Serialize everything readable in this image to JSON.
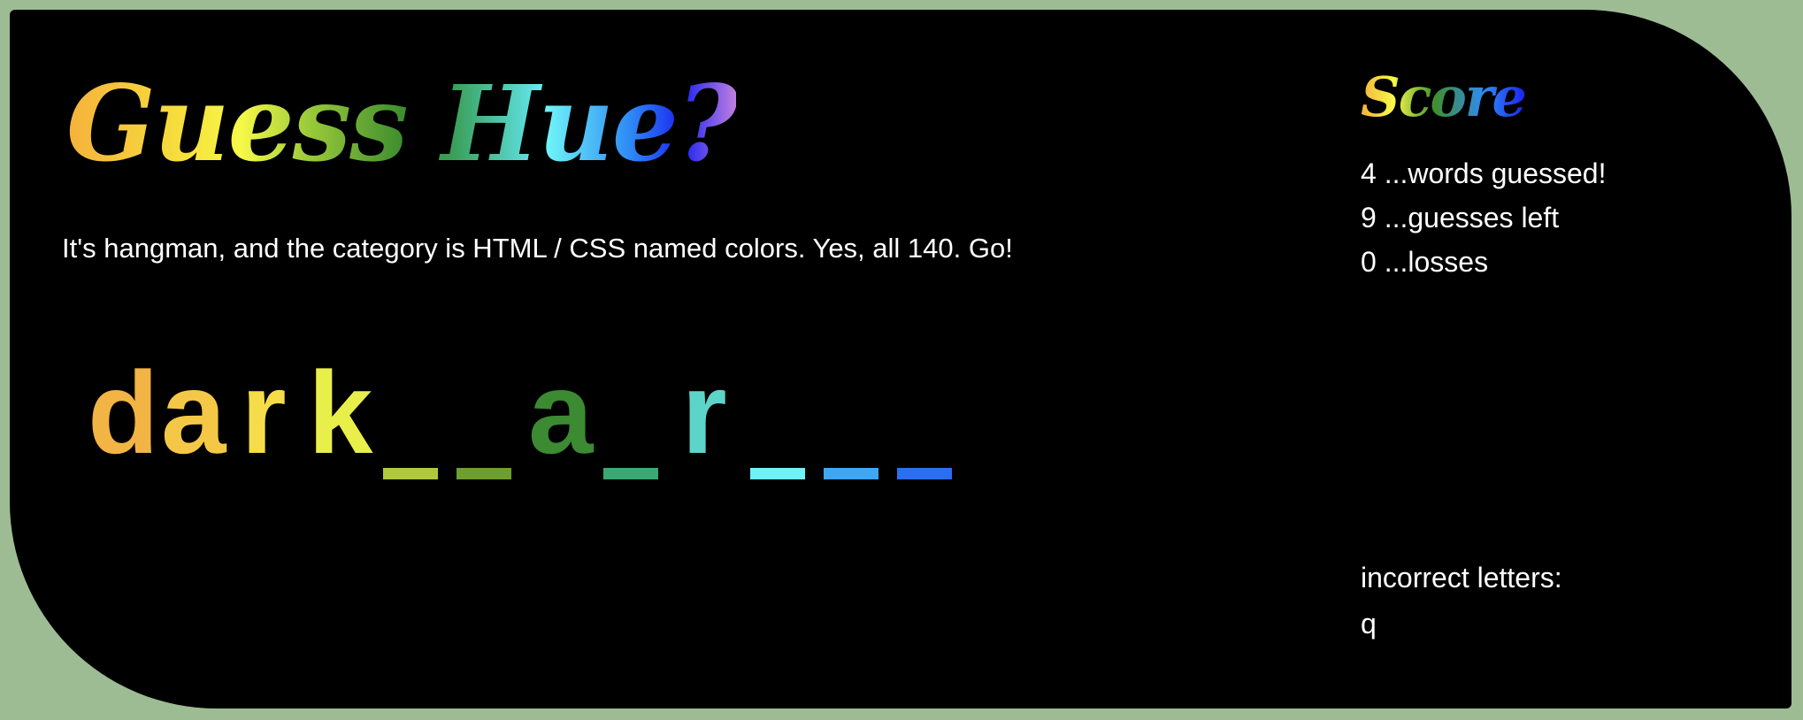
{
  "game": {
    "title": "Guess Hue?",
    "subtitle": "It's hangman, and the category is HTML / CSS named colors. Yes, all 140. Go!",
    "word": [
      {
        "char": "d",
        "revealed": true,
        "color": "#f2b444"
      },
      {
        "char": "a",
        "revealed": true,
        "color": "#f4c846"
      },
      {
        "char": "r",
        "revealed": true,
        "color": "#f5dc48"
      },
      {
        "char": "k",
        "revealed": true,
        "color": "#e9ef4a"
      },
      {
        "char": "",
        "revealed": false,
        "color": "#aec93a"
      },
      {
        "char": "",
        "revealed": false,
        "color": "#6d9e2e"
      },
      {
        "char": "a",
        "revealed": true,
        "color": "#3c8a32"
      },
      {
        "char": "",
        "revealed": false,
        "color": "#3aa872"
      },
      {
        "char": "r",
        "revealed": true,
        "color": "#5dd4c8"
      },
      {
        "char": "",
        "revealed": false,
        "color": "#6ef2f8"
      },
      {
        "char": "",
        "revealed": false,
        "color": "#3fa6f6"
      },
      {
        "char": "",
        "revealed": false,
        "color": "#2a6ef2"
      }
    ]
  },
  "score": {
    "title": "Score",
    "stats": [
      {
        "text": "4 ...words guessed!"
      },
      {
        "text": "9 ...guesses left"
      },
      {
        "text": "0 ...losses"
      }
    ],
    "incorrect_label": "incorrect letters:",
    "incorrect_letters": "q"
  },
  "colors": {
    "page_background": "#9ebc93",
    "card_background": "#000000",
    "text": "#ffffff"
  }
}
